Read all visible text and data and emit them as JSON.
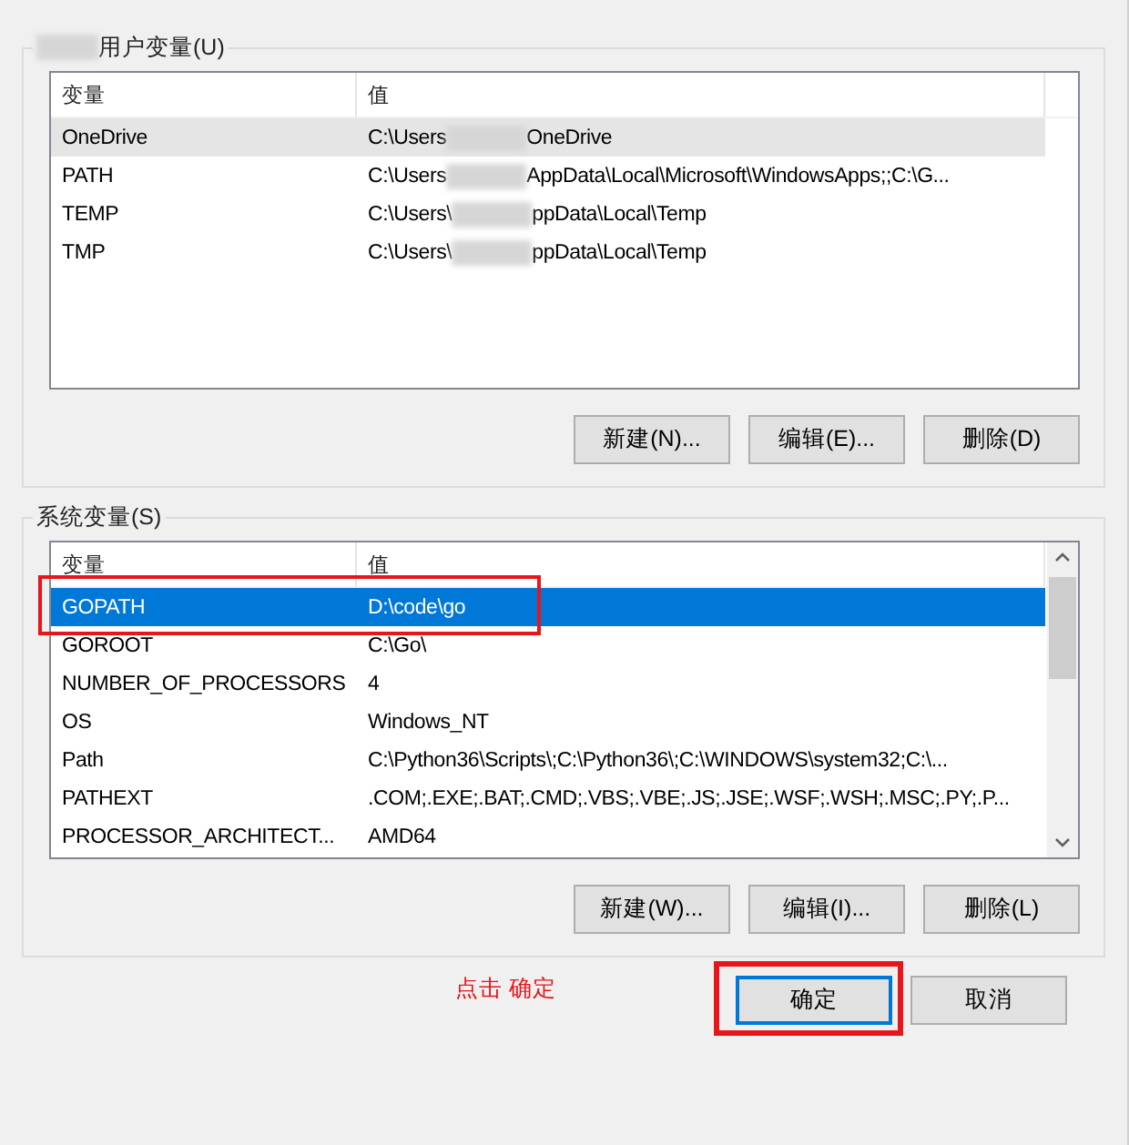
{
  "user_vars": {
    "title": "用户变量(U)",
    "title_redacted": true,
    "columns": [
      "变量",
      "值"
    ],
    "rows": [
      {
        "name": "OneDrive",
        "value": "C:\\Users",
        "value_tail": "OneDrive",
        "selected": false,
        "hover": true,
        "marked": false
      },
      {
        "name": "PATH",
        "value": "C:\\Users",
        "value_tail": "AppData\\Local\\Microsoft\\WindowsApps;;C:\\G...",
        "selected": false,
        "hover": false,
        "marked": false
      },
      {
        "name": "TEMP",
        "value": "C:\\Users\\",
        "value_tail": "ppData\\Local\\Temp",
        "selected": false,
        "hover": false,
        "marked": false
      },
      {
        "name": "TMP",
        "value": "C:\\Users\\",
        "value_tail": "ppData\\Local\\Temp",
        "selected": false,
        "hover": false,
        "marked": false
      }
    ],
    "scrollbar": false,
    "buttons": [
      "新建(N)...",
      "编辑(E)...",
      "删除(D)"
    ]
  },
  "system_vars": {
    "title": "系统变量(S)",
    "title_redacted": false,
    "columns": [
      "变量",
      "值"
    ],
    "rows": [
      {
        "name": "GOPATH",
        "value": "D:\\code\\go",
        "selected": true,
        "hover": false,
        "marked": true
      },
      {
        "name": "GOROOT",
        "value": "C:\\Go\\",
        "selected": false,
        "hover": false,
        "marked": false
      },
      {
        "name": "NUMBER_OF_PROCESSORS",
        "value": "4",
        "selected": false,
        "hover": false,
        "marked": false
      },
      {
        "name": "OS",
        "value": "Windows_NT",
        "selected": false,
        "hover": false,
        "marked": false
      },
      {
        "name": "Path",
        "value": "C:\\Python36\\Scripts\\;C:\\Python36\\;C:\\WINDOWS\\system32;C:\\...",
        "selected": false,
        "hover": false,
        "marked": false
      },
      {
        "name": "PATHEXT",
        "value": ".COM;.EXE;.BAT;.CMD;.VBS;.VBE;.JS;.JSE;.WSF;.WSH;.MSC;.PY;.P...",
        "selected": false,
        "hover": false,
        "marked": false
      },
      {
        "name": "PROCESSOR_ARCHITECT...",
        "value": "AMD64",
        "selected": false,
        "hover": false,
        "marked": false
      }
    ],
    "scrollbar": true,
    "buttons": [
      "新建(W)...",
      "编辑(I)...",
      "删除(L)"
    ]
  },
  "annotation": "点击 确定",
  "dialog_buttons": [
    {
      "label": "确定",
      "default": true,
      "marked": true
    },
    {
      "label": "取消",
      "default": false,
      "marked": false
    }
  ]
}
